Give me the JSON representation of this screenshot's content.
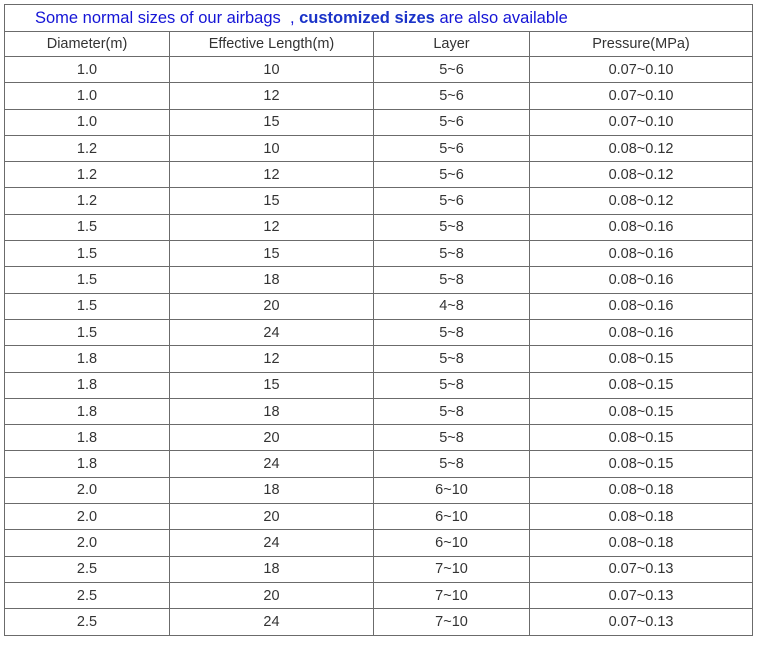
{
  "caption": {
    "prefix": "Some normal sizes of our airbags  ,",
    "emphasis": "customized sizes",
    "suffix": "are also available"
  },
  "headers": [
    "Diameter(m)",
    "Effective Length(m)",
    "Layer",
    "Pressure(MPa)"
  ],
  "rows": [
    [
      "1.0",
      "10",
      "5~6",
      "0.07~0.10"
    ],
    [
      "1.0",
      "12",
      "5~6",
      "0.07~0.10"
    ],
    [
      "1.0",
      "15",
      "5~6",
      "0.07~0.10"
    ],
    [
      "1.2",
      "10",
      "5~6",
      "0.08~0.12"
    ],
    [
      "1.2",
      "12",
      "5~6",
      "0.08~0.12"
    ],
    [
      "1.2",
      "15",
      "5~6",
      "0.08~0.12"
    ],
    [
      "1.5",
      "12",
      "5~8",
      "0.08~0.16"
    ],
    [
      "1.5",
      "15",
      "5~8",
      "0.08~0.16"
    ],
    [
      "1.5",
      "18",
      "5~8",
      "0.08~0.16"
    ],
    [
      "1.5",
      "20",
      "4~8",
      "0.08~0.16"
    ],
    [
      "1.5",
      "24",
      "5~8",
      "0.08~0.16"
    ],
    [
      "1.8",
      "12",
      "5~8",
      "0.08~0.15"
    ],
    [
      "1.8",
      "15",
      "5~8",
      "0.08~0.15"
    ],
    [
      "1.8",
      "18",
      "5~8",
      "0.08~0.15"
    ],
    [
      "1.8",
      "20",
      "5~8",
      "0.08~0.15"
    ],
    [
      "1.8",
      "24",
      "5~8",
      "0.08~0.15"
    ],
    [
      "2.0",
      "18",
      "6~10",
      "0.08~0.18"
    ],
    [
      "2.0",
      "20",
      "6~10",
      "0.08~0.18"
    ],
    [
      "2.0",
      "24",
      "6~10",
      "0.08~0.18"
    ],
    [
      "2.5",
      "18",
      "7~10",
      "0.07~0.13"
    ],
    [
      "2.5",
      "20",
      "7~10",
      "0.07~0.13"
    ],
    [
      "2.5",
      "24",
      "7~10",
      "0.07~0.13"
    ]
  ],
  "colors": {
    "caption_text": "#1515d6",
    "border": "#6b6b6b",
    "cell_text": "#333333"
  }
}
